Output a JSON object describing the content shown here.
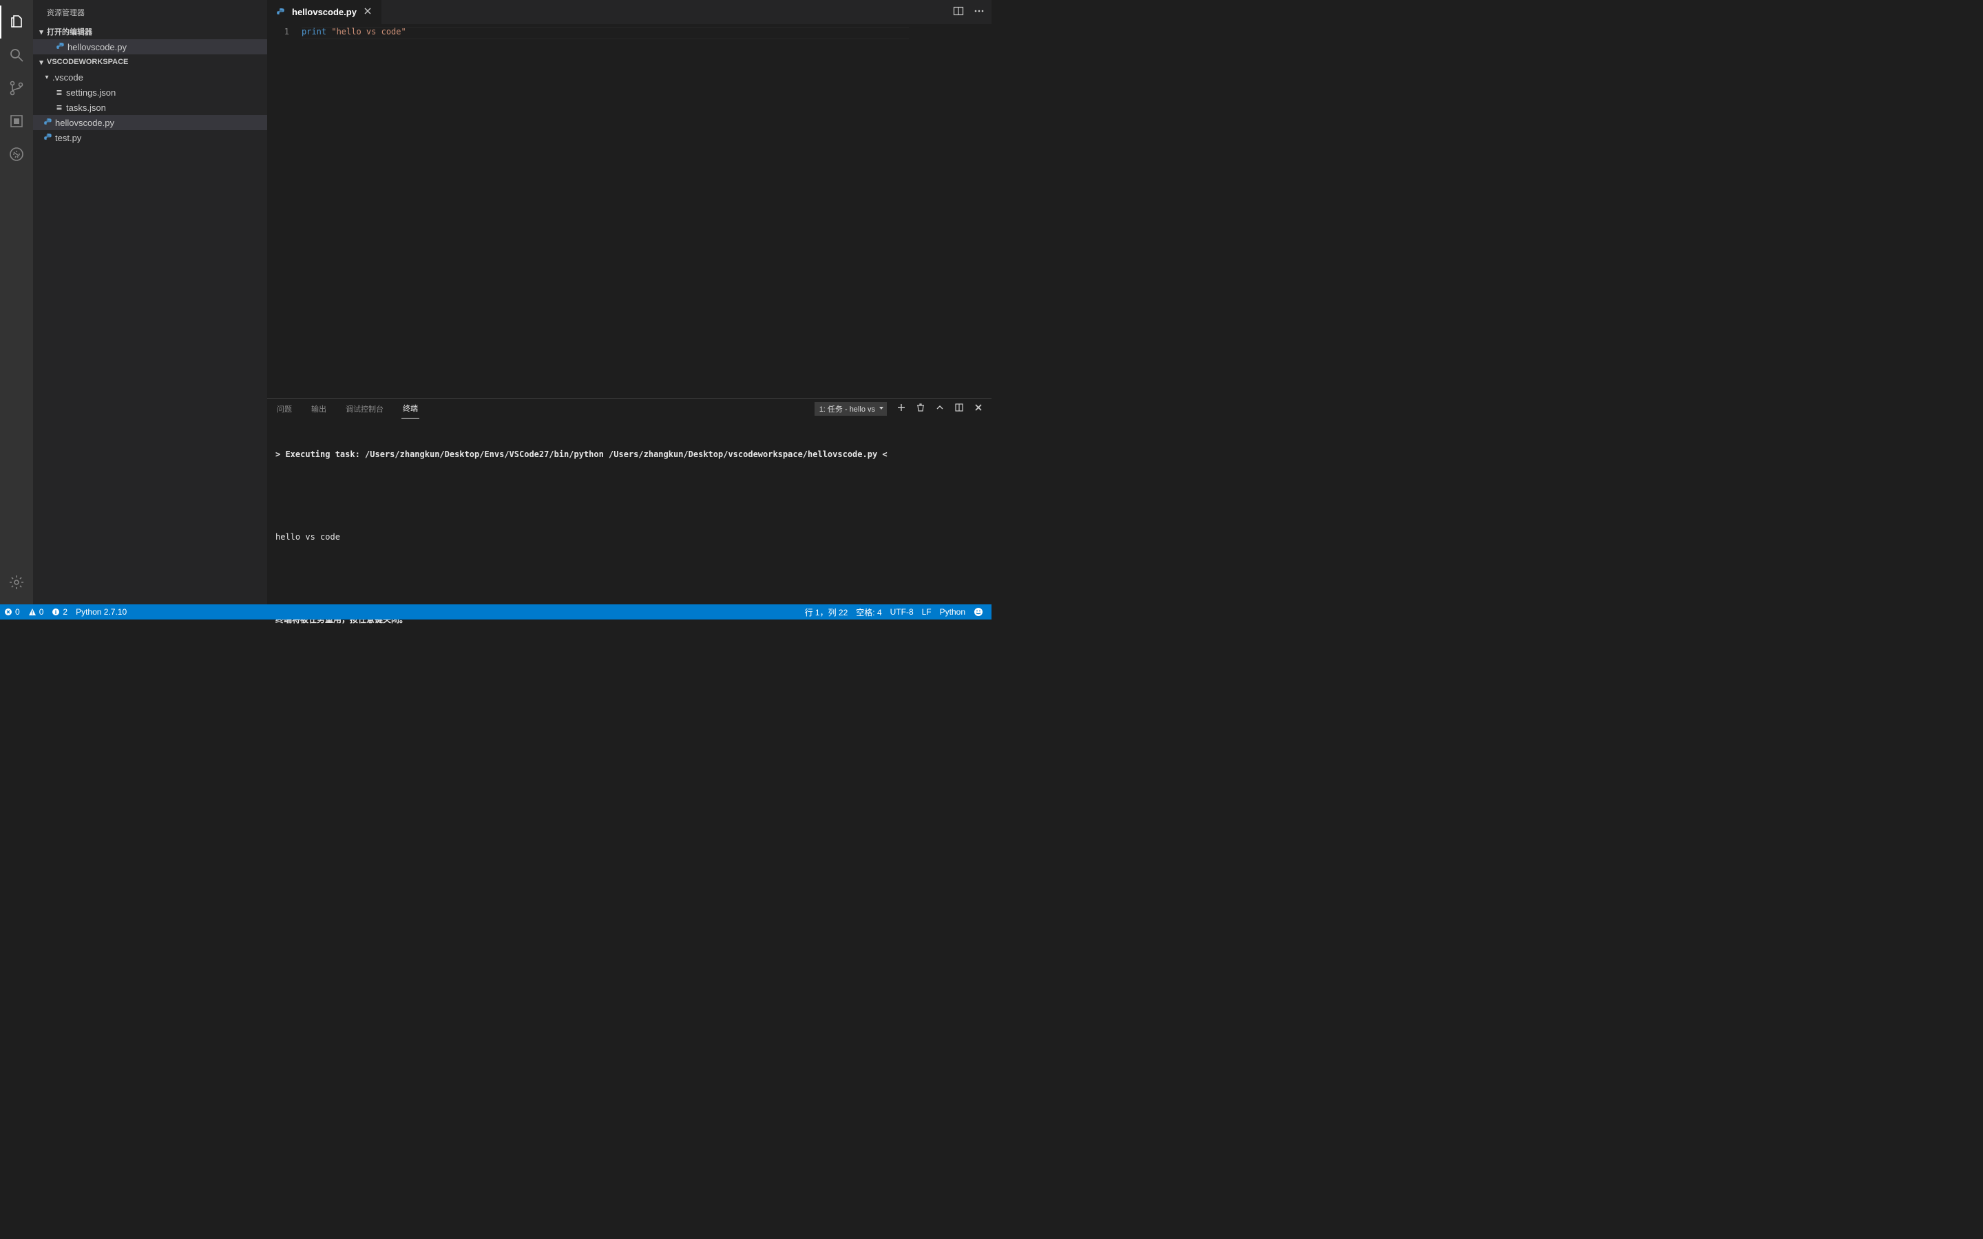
{
  "sidebar": {
    "title": "资源管理器",
    "openEditorsHeader": "打开的编辑器",
    "openEditors": [
      {
        "label": "hellovscode.py",
        "icon": "python"
      }
    ],
    "workspaceHeader": "VSCODEWORKSPACE",
    "tree": {
      "folder": {
        "label": ".vscode"
      },
      "folderFiles": [
        {
          "label": "settings.json",
          "icon": "json"
        },
        {
          "label": "tasks.json",
          "icon": "json"
        }
      ],
      "rootFiles": [
        {
          "label": "hellovscode.py",
          "icon": "python",
          "selected": true
        },
        {
          "label": "test.py",
          "icon": "python"
        }
      ]
    }
  },
  "tabs": {
    "active": {
      "label": "hellovscode.py",
      "icon": "python"
    }
  },
  "editor": {
    "lineNumber": "1",
    "tokens": {
      "kw": "print",
      "sp": " ",
      "str": "\"hello vs code\""
    }
  },
  "panel": {
    "tabs": {
      "problems": "问题",
      "output": "输出",
      "debug": "调试控制台",
      "terminal": "终端"
    },
    "terminalSelector": "1: 任务 - hello vs",
    "lines": {
      "l1a": "> Executing task: /Users/zhangkun/Desktop/Envs/VSCode27/bin/python /Users/zhangkun/Desktop/vscodeworkspace/hellovscode.py <",
      "l2": "hello vs code",
      "l3": "终端将被任务重用，按任意键关闭。"
    }
  },
  "status": {
    "errors": "0",
    "warnings": "0",
    "info": "2",
    "python": "Python 2.7.10",
    "lineCol": "行 1，列 22",
    "spaces": "空格: 4",
    "encoding": "UTF-8",
    "eol": "LF",
    "language": "Python"
  }
}
